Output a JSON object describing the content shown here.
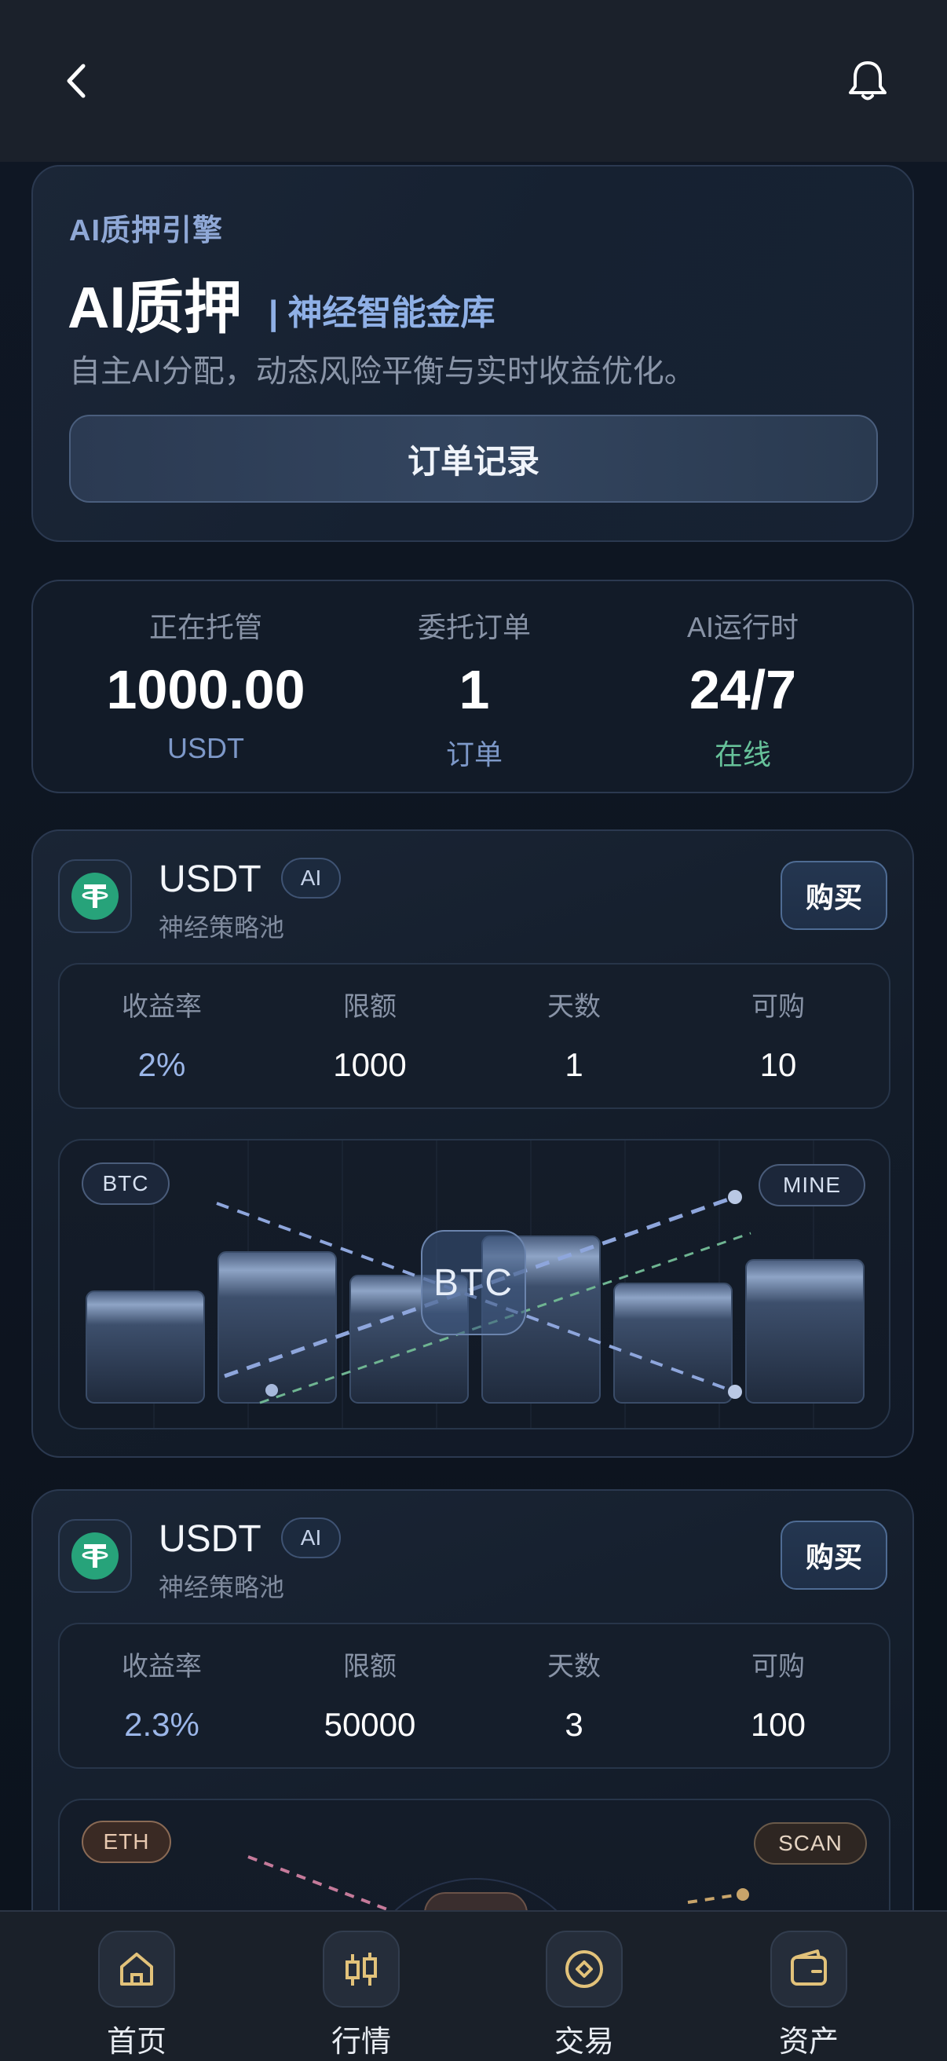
{
  "header": {
    "back_icon": "chevron-left-icon",
    "bell_icon": "bell-icon"
  },
  "hero": {
    "kicker": "AI质押引擎",
    "title": "AI质押",
    "subtitle": "| 神经智能金库",
    "description": "自主AI分配，动态风险平衡与实时收益优化。",
    "orders_button": "订单记录"
  },
  "stats": [
    {
      "label": "正在托管",
      "value": "1000.00",
      "unit": "USDT"
    },
    {
      "label": "委托订单",
      "value": "1",
      "unit": "订单"
    },
    {
      "label": "AI运行时",
      "value": "24/7",
      "unit": "在线",
      "unit_color": "#67c29a"
    }
  ],
  "products": [
    {
      "name": "USDT",
      "badge": "AI",
      "subtitle": "神经策略池",
      "buy_label": "购买",
      "metrics": [
        {
          "label": "收益率",
          "value": "2%"
        },
        {
          "label": "限额",
          "value": "1000"
        },
        {
          "label": "天数",
          "value": "1"
        },
        {
          "label": "可购",
          "value": "10"
        }
      ],
      "viz": {
        "left_tag": "BTC",
        "right_tag": "MINE",
        "center": "BTC"
      }
    },
    {
      "name": "USDT",
      "badge": "AI",
      "subtitle": "神经策略池",
      "buy_label": "购买",
      "metrics": [
        {
          "label": "收益率",
          "value": "2.3%"
        },
        {
          "label": "限额",
          "value": "50000"
        },
        {
          "label": "天数",
          "value": "3"
        },
        {
          "label": "可购",
          "value": "100"
        }
      ],
      "viz": {
        "left_tag": "ETH",
        "right_tag": "SCAN"
      }
    }
  ],
  "nav": [
    {
      "label": "首页",
      "icon": "home-icon"
    },
    {
      "label": "行情",
      "icon": "candlestick-icon"
    },
    {
      "label": "交易",
      "icon": "swap-diamond-icon"
    },
    {
      "label": "资产",
      "icon": "wallet-icon"
    }
  ],
  "colors": {
    "accent": "#8fb0e6",
    "gold": "#e2c27a",
    "tether": "#27a37a",
    "online": "#67c29a"
  }
}
